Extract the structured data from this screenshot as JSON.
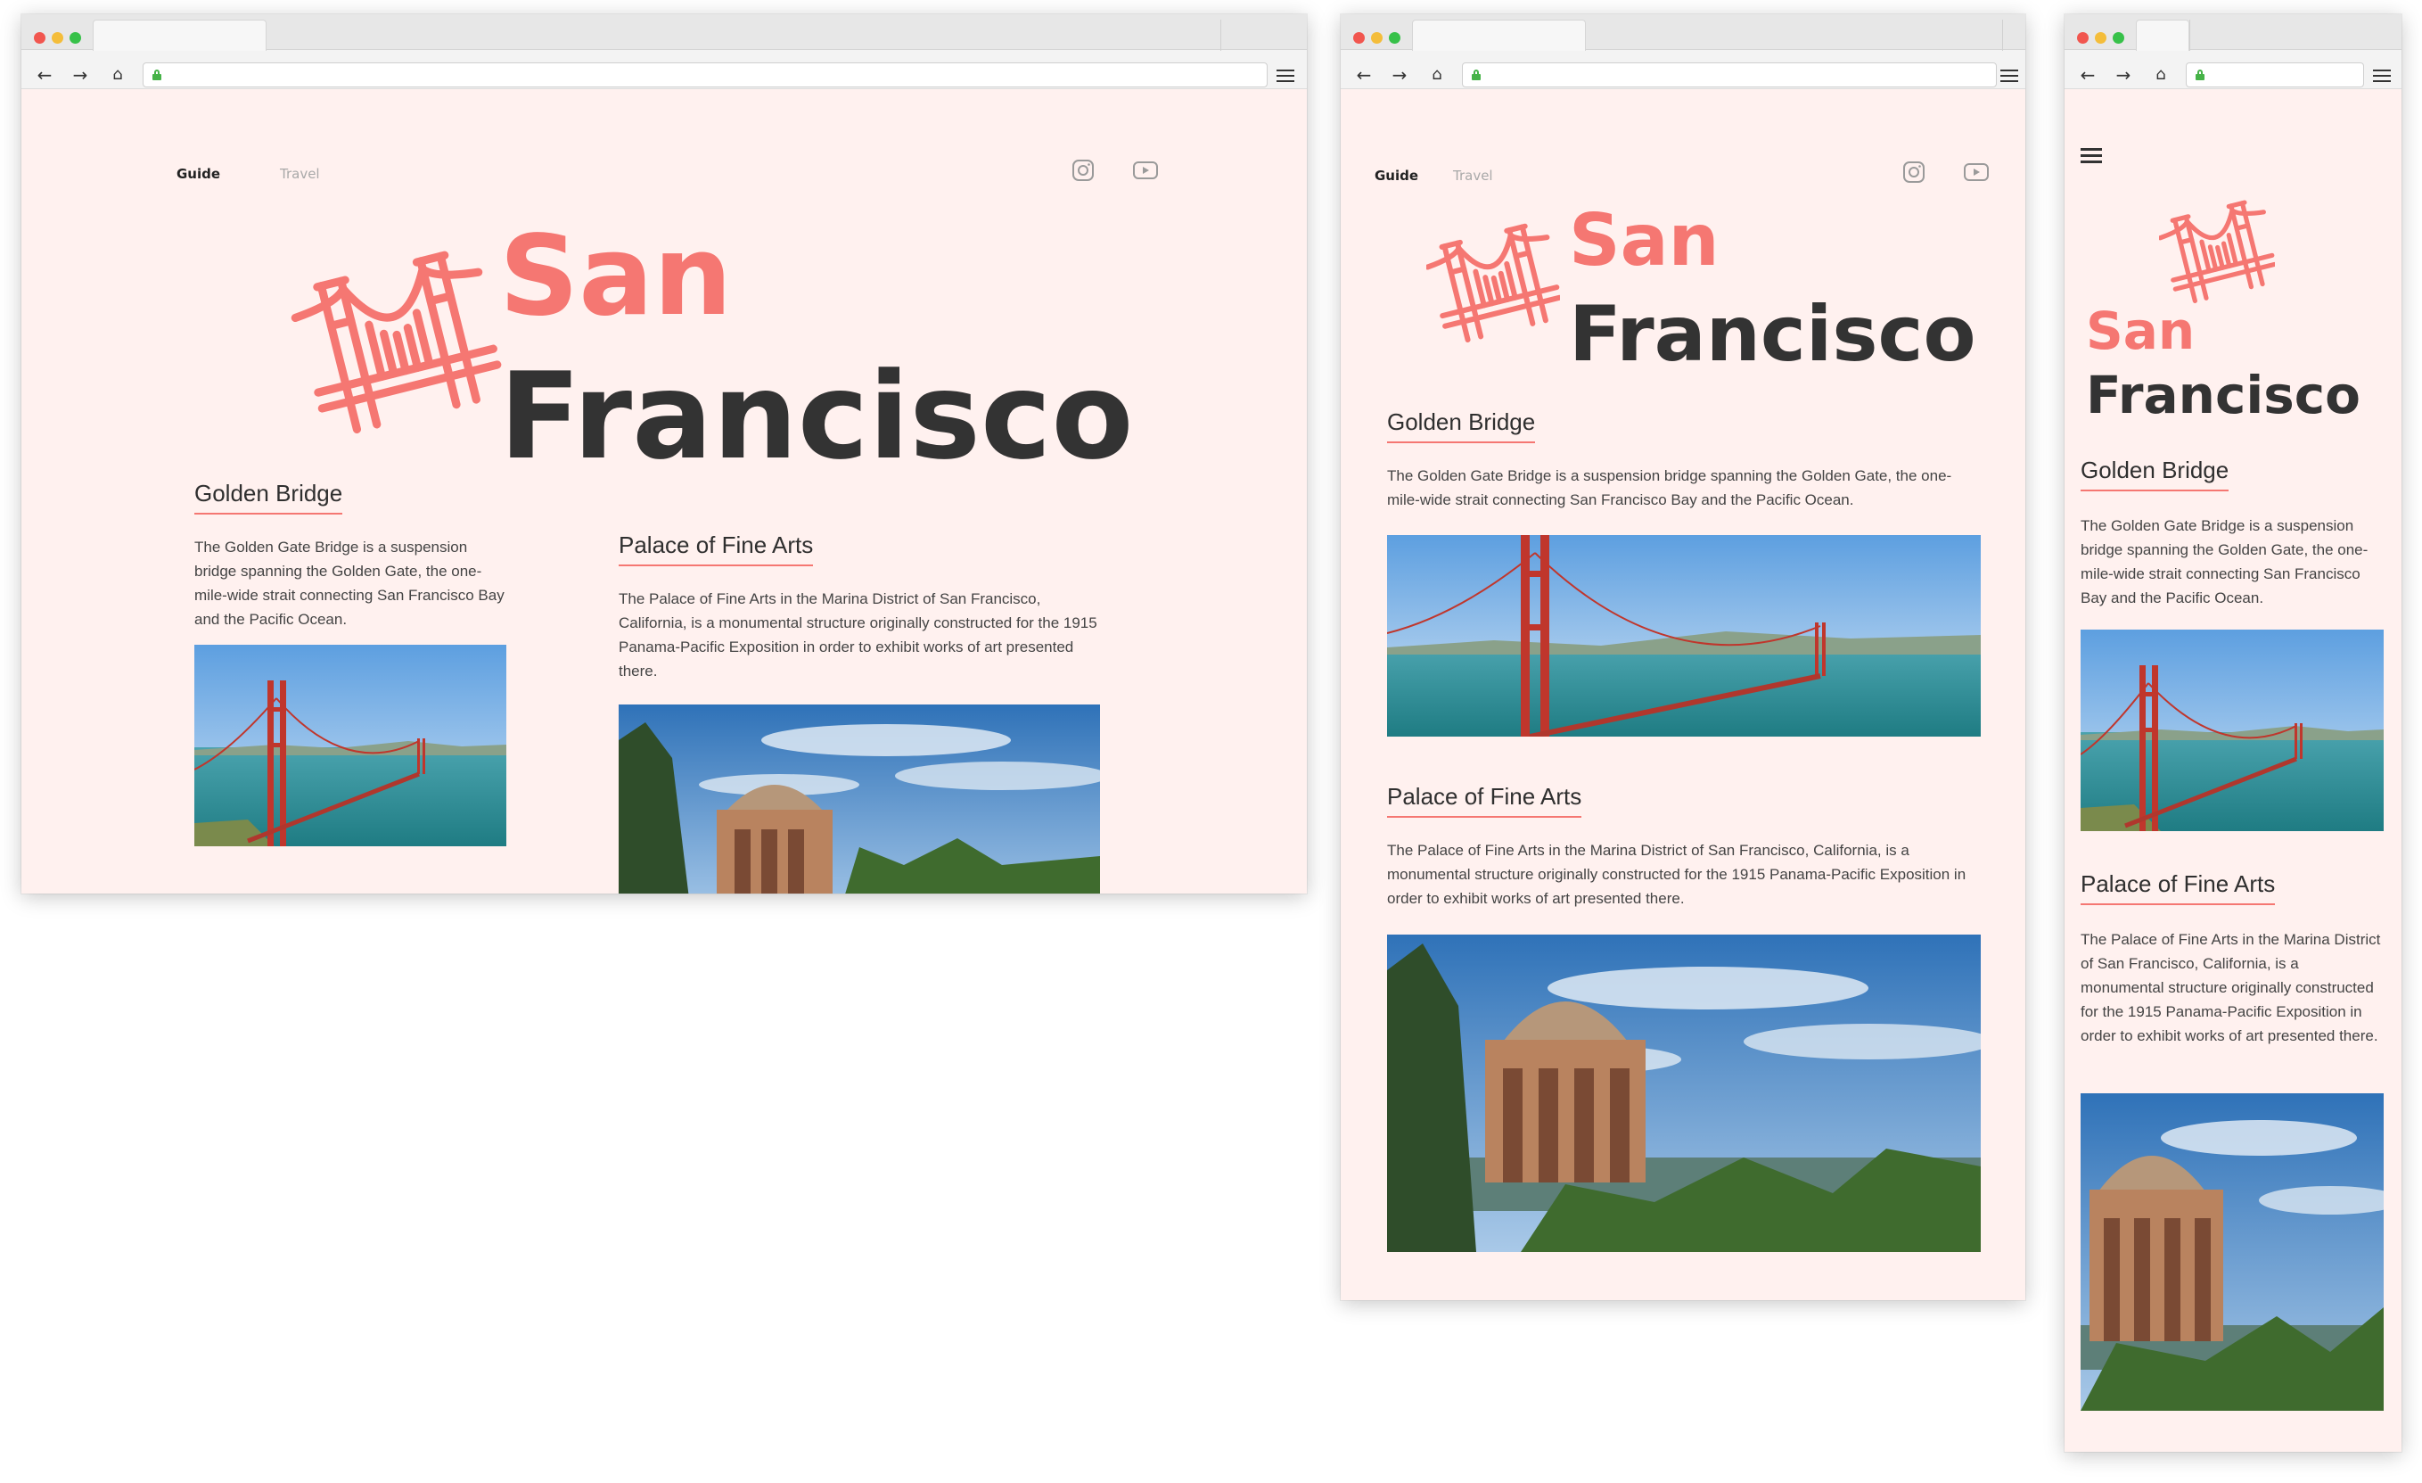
{
  "site": {
    "nav": {
      "guide": "Guide",
      "travel": "Travel"
    },
    "title_line1": "San",
    "title_line2": "Francisco"
  },
  "sections": {
    "golden": {
      "heading": "Golden Bridge",
      "text": "The Golden Gate Bridge is a suspension bridge spanning the Golden Gate, the one-mile-wide strait connecting San Francisco Bay and the Pacific Ocean."
    },
    "palace": {
      "heading": "Palace of Fine Arts",
      "text": "The Palace of Fine Arts in the Marina District of San Francisco, California, is a monumental structure originally constructed for the 1915 Panama-Pacific Exposition in order to exhibit works of art presented there."
    }
  },
  "icons": {
    "logo": "golden-gate-bridge-icon",
    "social_1": "instagram-icon",
    "social_2": "youtube-icon",
    "lock": "lock-icon",
    "menu": "hamburger-menu-icon"
  },
  "colors": {
    "accent": "#f57772",
    "title_dark": "#333333",
    "page_bg": "#fff1ef",
    "secure_lock": "#46b348"
  }
}
